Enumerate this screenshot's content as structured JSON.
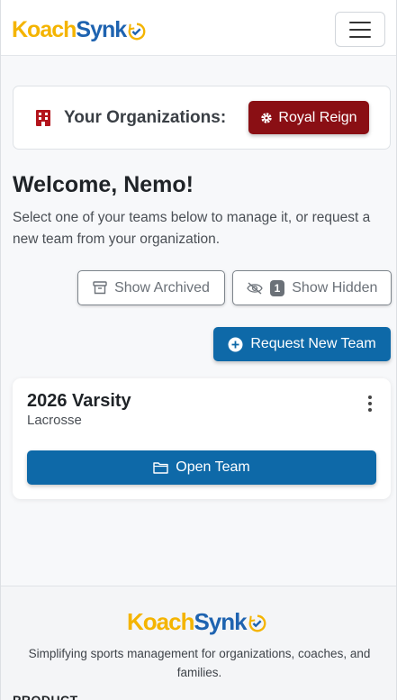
{
  "brand": {
    "part1": "Koach",
    "part2": "Synk",
    "accent_yellow": "#f4b400",
    "accent_blue": "#1e63b0"
  },
  "header": {
    "menu_icon": "hamburger-icon"
  },
  "organizations": {
    "label": "Your Organizations:",
    "icon": "building-icon",
    "selected_org": "Royal Reign",
    "org_button_icon": "gear-icon",
    "org_color": "#8a0f14"
  },
  "welcome": {
    "title": "Welcome, Nemo!",
    "subtitle": "Select one of your teams below to manage it, or request a new team from your organization."
  },
  "filters": {
    "archived_label": "Show Archived",
    "archived_icon": "archive-icon",
    "hidden_label": "Show Hidden",
    "hidden_icon": "eye-slash-icon",
    "hidden_count": "1"
  },
  "actions": {
    "request_team_label": "Request New Team",
    "request_team_icon": "plus-circle-icon",
    "primary_color": "#0e69a8"
  },
  "teams": [
    {
      "name": "2026 Varsity",
      "sport": "Lacrosse",
      "open_label": "Open Team",
      "open_icon": "folder-icon",
      "menu_icon": "kebab-icon"
    }
  ],
  "footer": {
    "tagline": "Simplifying sports management for organizations, coaches, and families.",
    "section_heading": "PRODUCT"
  }
}
